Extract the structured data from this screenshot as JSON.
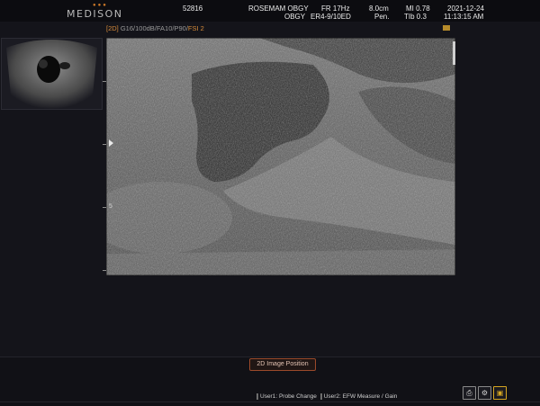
{
  "header": {
    "logo": "MEDISON",
    "logo_dots": "●●●",
    "patient_id": "52816",
    "hospital": "ROSEMAM OBGY",
    "dept": "OBGY",
    "frame_rate": "FR 17Hz",
    "probe": "ER4-9/10ED",
    "depth": "8.0cm",
    "pen": "Pen.",
    "mi": "MI 0.78",
    "tib": "TIb 0.3",
    "date": "2021-12-24",
    "time": "11:13:15 AM"
  },
  "mode": {
    "prefix": "[2D]",
    "params": " G16/100dB/FA10/P90/",
    "fsi": "FSI 2"
  },
  "markers": {
    "m_label": "M"
  },
  "scale": {
    "label_5": "5"
  },
  "footer": {
    "position_button": "2D Image Position",
    "user1": "User1: Probe Change",
    "user2": "User2: EFW Measure / Gain"
  },
  "icons": [
    "print-icon",
    "settings-icon",
    "save-icon"
  ],
  "colors": {
    "accent": "#d58a3a",
    "button_border": "#9b4a2a",
    "background": "#14141a"
  }
}
